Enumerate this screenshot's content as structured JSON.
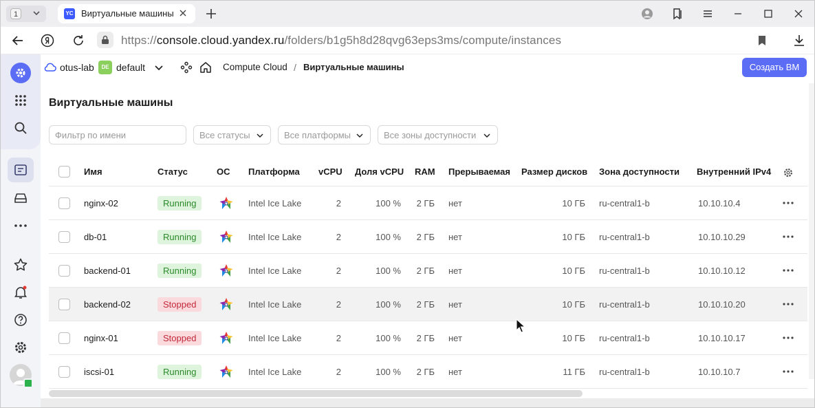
{
  "browser": {
    "tab_count": "1",
    "tab_favicon": "YC",
    "tab_title": "Виртуальные машины",
    "url_prefix": "https://",
    "url_host": "console.cloud.yandex.ru",
    "url_path": "/folders/b1g5h8d28qvg63eps3ms/compute/instances"
  },
  "header": {
    "cloud": "otus-lab",
    "folder_badge": "DE",
    "folder": "default",
    "service": "Compute Cloud",
    "separator": "/",
    "current": "Виртуальные машины",
    "create_label": "Создать ВМ"
  },
  "page": {
    "title": "Виртуальные машины",
    "filters": {
      "name_placeholder": "Фильтр по имени",
      "statuses": "Все статусы",
      "platforms": "Все платформы",
      "zones": "Все зоны доступности"
    }
  },
  "table": {
    "columns": [
      "Имя",
      "Статус",
      "ОС",
      "Платформа",
      "vCPU",
      "Доля vCPU",
      "RAM",
      "Прерываемая",
      "Размер дисков",
      "Зона доступности",
      "Внутренний IPv4"
    ],
    "rows": [
      {
        "name": "nginx-02",
        "status": "Running",
        "platform": "Intel Ice Lake",
        "vcpu": "2",
        "share": "100 %",
        "ram": "2 ГБ",
        "preempt": "нет",
        "disk": "10 ГБ",
        "zone": "ru-central1-b",
        "ip": "10.10.10.4"
      },
      {
        "name": "db-01",
        "status": "Running",
        "platform": "Intel Ice Lake",
        "vcpu": "2",
        "share": "100 %",
        "ram": "2 ГБ",
        "preempt": "нет",
        "disk": "10 ГБ",
        "zone": "ru-central1-b",
        "ip": "10.10.10.29"
      },
      {
        "name": "backend-01",
        "status": "Running",
        "platform": "Intel Ice Lake",
        "vcpu": "2",
        "share": "100 %",
        "ram": "2 ГБ",
        "preempt": "нет",
        "disk": "10 ГБ",
        "zone": "ru-central1-b",
        "ip": "10.10.10.12"
      },
      {
        "name": "backend-02",
        "status": "Stopped",
        "platform": "Intel Ice Lake",
        "vcpu": "2",
        "share": "100 %",
        "ram": "2 ГБ",
        "preempt": "нет",
        "disk": "10 ГБ",
        "zone": "ru-central1-b",
        "ip": "10.10.10.20"
      },
      {
        "name": "nginx-01",
        "status": "Stopped",
        "platform": "Intel Ice Lake",
        "vcpu": "2",
        "share": "100 %",
        "ram": "2 ГБ",
        "preempt": "нет",
        "disk": "10 ГБ",
        "zone": "ru-central1-b",
        "ip": "10.10.10.17"
      },
      {
        "name": "iscsi-01",
        "status": "Running",
        "platform": "Intel Ice Lake",
        "vcpu": "2",
        "share": "100 %",
        "ram": "2 ГБ",
        "preempt": "нет",
        "disk": "11 ГБ",
        "zone": "ru-central1-b",
        "ip": "10.10.10.7"
      }
    ]
  },
  "colors": {
    "accent": "#5b6cf5",
    "running_bg": "#dff4dc",
    "running_fg": "#2a8a2a",
    "stopped_bg": "#fadadd",
    "stopped_fg": "#c3283a"
  },
  "icons": [
    "yandex-icon",
    "back-icon",
    "reload-icon",
    "lock-icon",
    "bookmark-icon",
    "download-icon",
    "cloud-icon",
    "chevron-down-icon",
    "services-icon",
    "home-icon",
    "settings-icon",
    "more-icon",
    "os-icon",
    "cursor-icon"
  ]
}
